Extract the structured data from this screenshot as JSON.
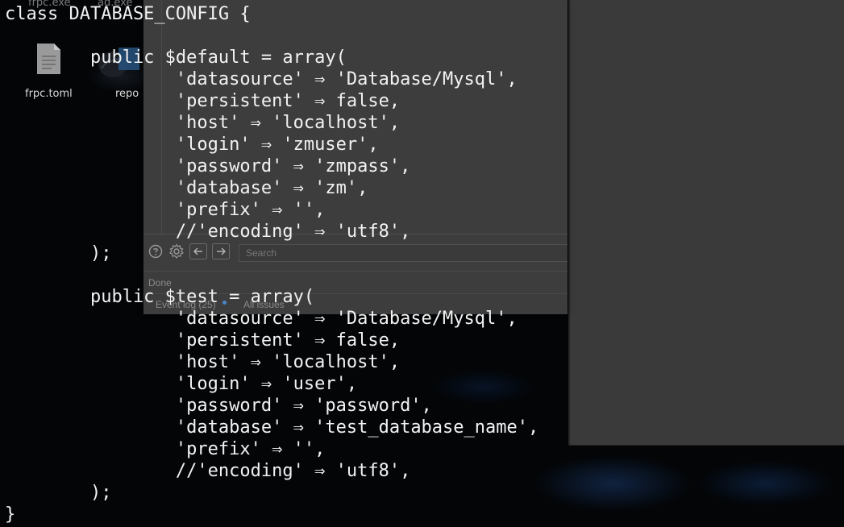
{
  "desktop": {
    "top_items": [
      "frpc.exe",
      "ad.exe"
    ],
    "icons": [
      {
        "label": "frpc.toml",
        "icon": "document-icon"
      },
      {
        "label": "repo",
        "icon": "folder-icon"
      }
    ]
  },
  "app_window": {
    "toolbar": {
      "help_icon": "help-icon",
      "settings_icon": "gear-icon",
      "back_icon": "arrow-left-icon",
      "forward_icon": "arrow-right-icon",
      "search_placeholder": "Search"
    },
    "status_text": "Done",
    "tabs": [
      {
        "label": "Event log (25)"
      },
      {
        "label": "All issues"
      }
    ]
  },
  "code": {
    "lines": [
      "class DATABASE_CONFIG {",
      "",
      "        public $default = array(",
      "                'datasource' ⇒ 'Database/Mysql',",
      "                'persistent' ⇒ false,",
      "                'host' ⇒ 'localhost',",
      "                'login' ⇒ 'zmuser',",
      "                'password' ⇒ 'zmpass',",
      "                'database' ⇒ 'zm',",
      "                'prefix' ⇒ '',",
      "                //'encoding' ⇒ 'utf8',",
      "        );",
      "",
      "        public $test = array(",
      "                'datasource' ⇒ 'Database/Mysql',",
      "                'persistent' ⇒ false,",
      "                'host' ⇒ 'localhost',",
      "                'login' ⇒ 'user',",
      "                'password' ⇒ 'password',",
      "                'database' ⇒ 'test_database_name',",
      "                'prefix' ⇒ '',",
      "                //'encoding' ⇒ 'utf8',",
      "        );",
      "}"
    ]
  },
  "colors": {
    "code_text": "#f2f2f2",
    "selection": "#264f78",
    "window_bg": "#3d3d3d",
    "panel_bg": "#3a3a3a"
  }
}
